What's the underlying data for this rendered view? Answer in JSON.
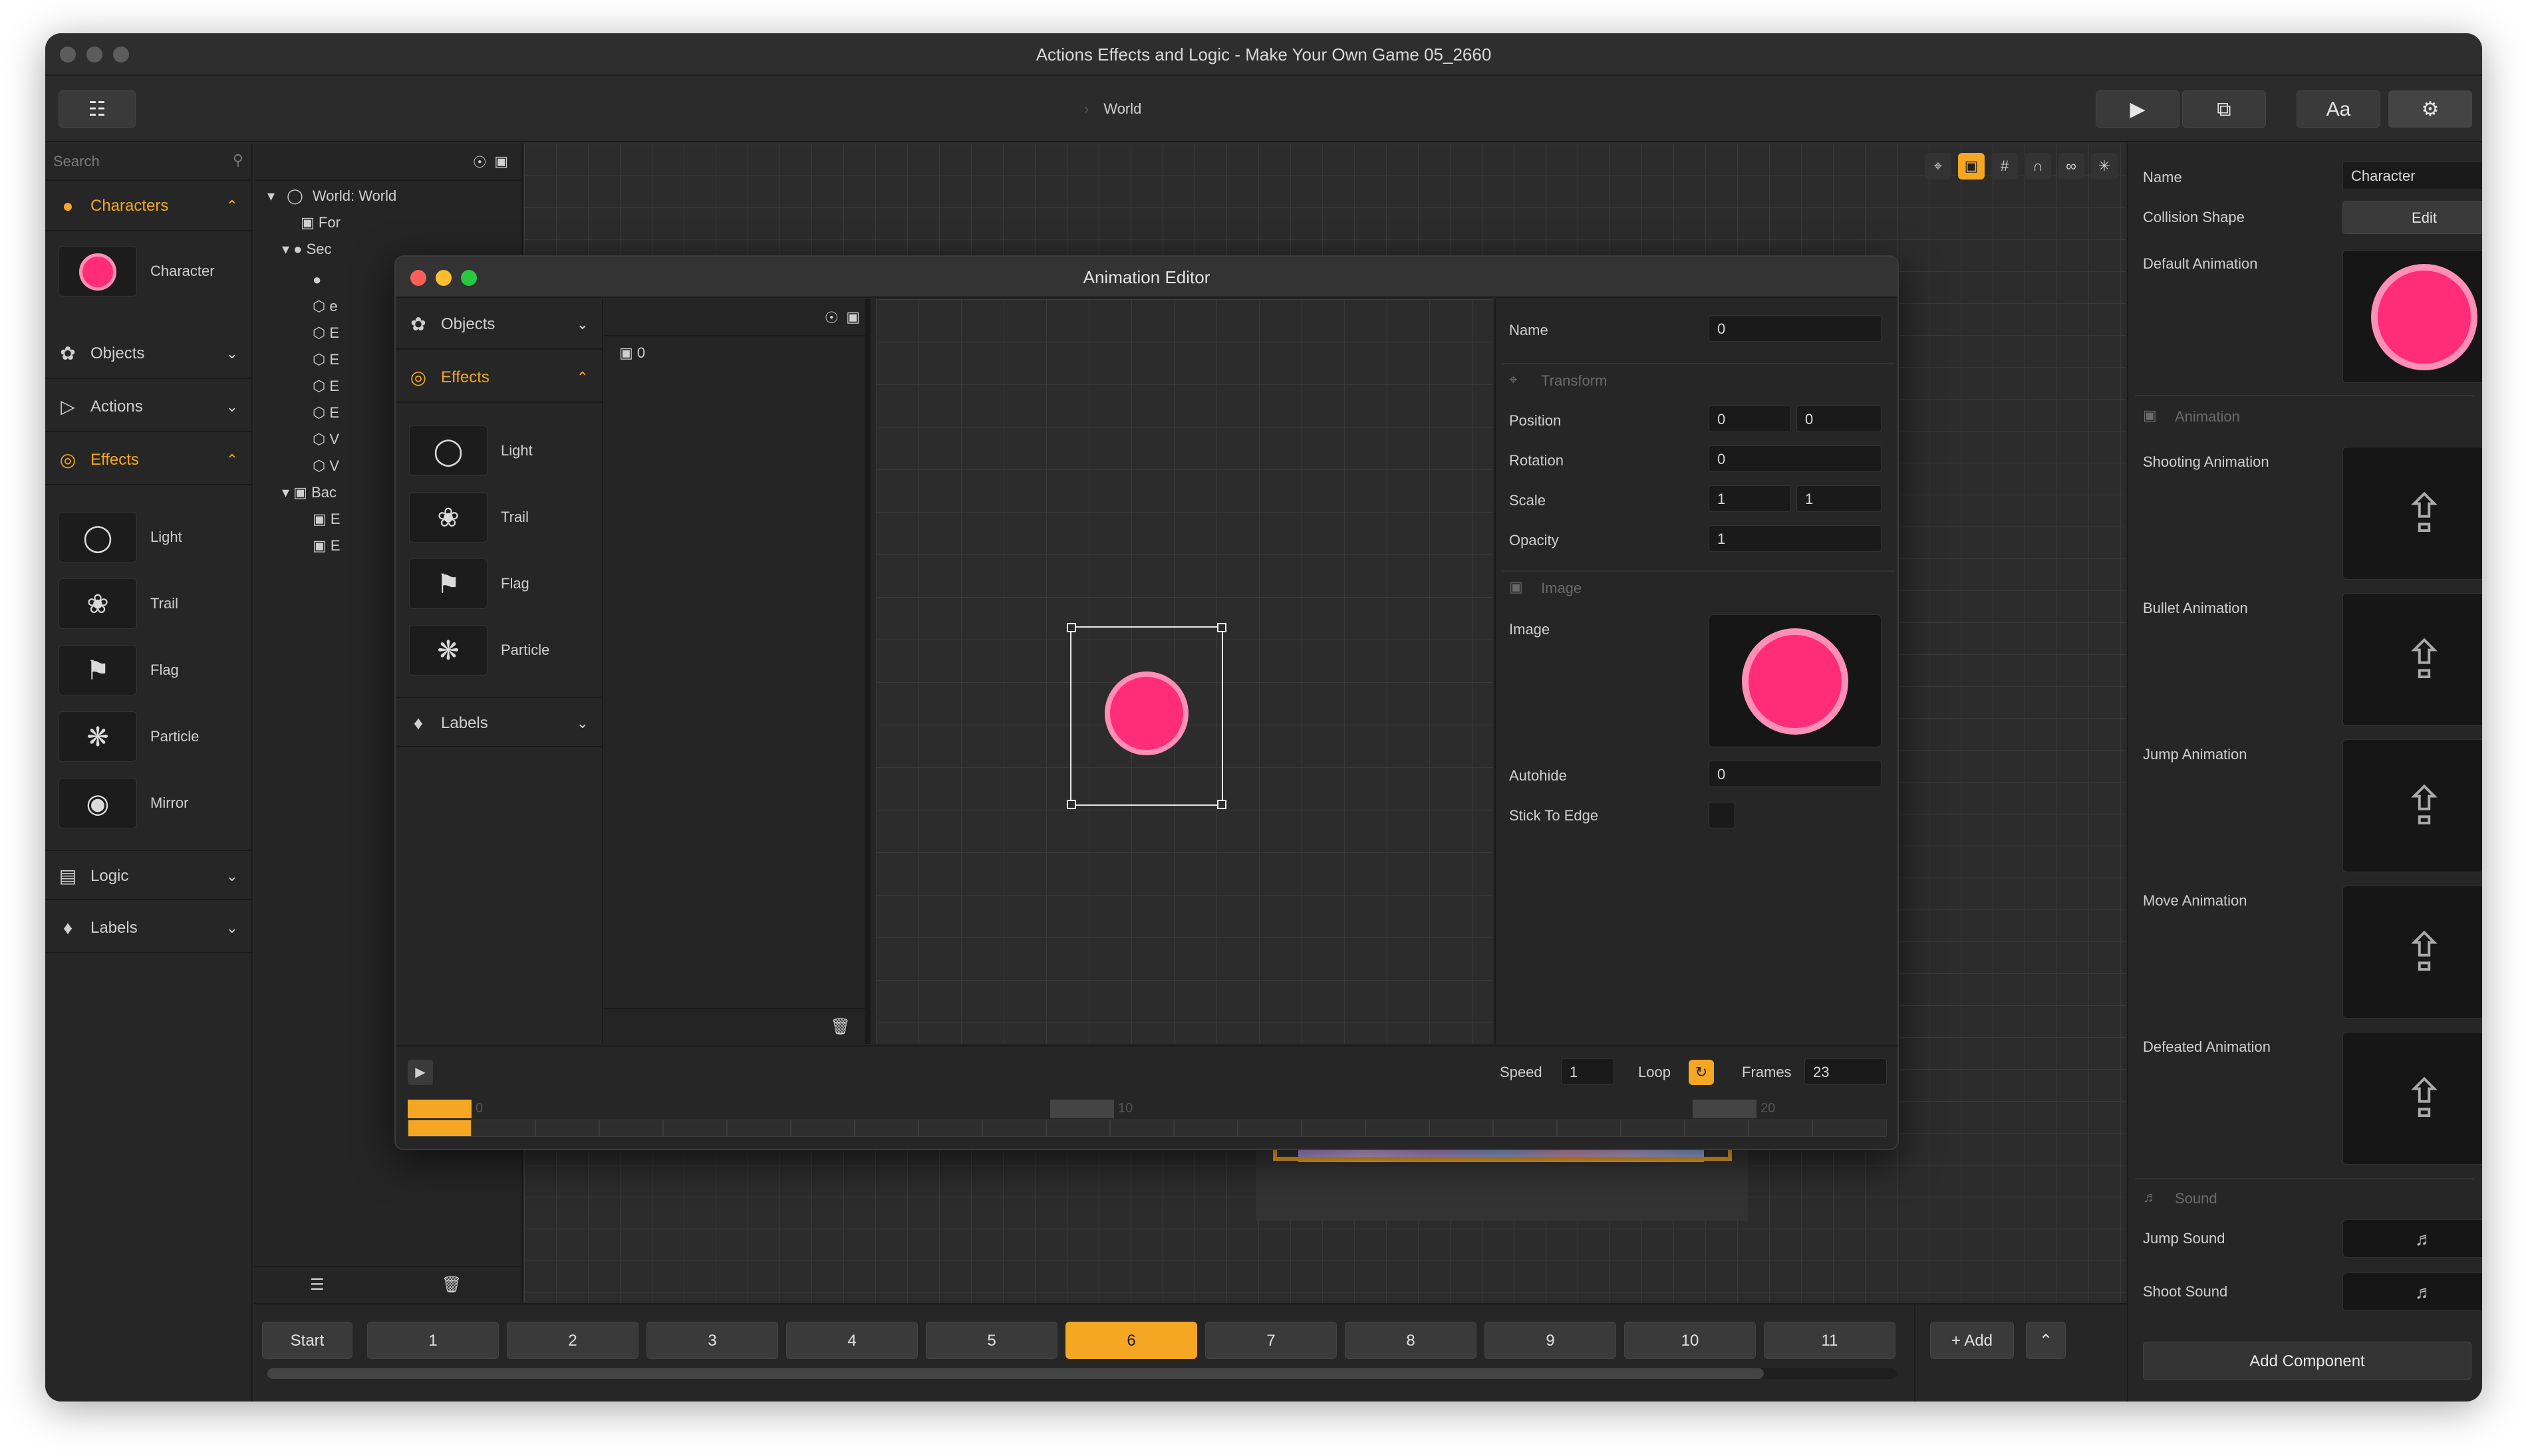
{
  "window": {
    "title": "Actions Effects and Logic - Make Your Own Game 05_2660"
  },
  "toolbar": {
    "breadcrumb": "World",
    "play_icon": "play-icon",
    "share_icon": "share-icon",
    "font_label": "Aa",
    "settings_icon": "gear-icon"
  },
  "sidebar": {
    "search_placeholder": "Search",
    "characters": {
      "label": "Characters",
      "items": [
        {
          "label": "Character"
        }
      ]
    },
    "objects": {
      "label": "Objects"
    },
    "actions": {
      "label": "Actions"
    },
    "effects": {
      "label": "Effects",
      "items": [
        {
          "label": "Light"
        },
        {
          "label": "Trail"
        },
        {
          "label": "Flag"
        },
        {
          "label": "Particle"
        },
        {
          "label": "Mirror"
        }
      ]
    },
    "logic": {
      "label": "Logic"
    },
    "labels": {
      "label": "Labels"
    }
  },
  "tree": {
    "root": "World: World",
    "rows": [
      "For",
      "Sec",
      "",
      "e",
      "E",
      "E",
      "E",
      "E",
      "V",
      "V",
      "Bac",
      "E",
      "E"
    ]
  },
  "animation_editor": {
    "title": "Animation Editor",
    "left": {
      "objects": "Objects",
      "effects": "Effects",
      "items": [
        {
          "label": "Light"
        },
        {
          "label": "Trail"
        },
        {
          "label": "Flag"
        },
        {
          "label": "Particle"
        }
      ],
      "labels": "Labels"
    },
    "layers": {
      "first": "0"
    },
    "props": {
      "name_label": "Name",
      "name_value": "0",
      "transform_section": "Transform",
      "position_label": "Position",
      "position_x": "0",
      "position_y": "0",
      "rotation_label": "Rotation",
      "rotation_value": "0",
      "scale_label": "Scale",
      "scale_x": "1",
      "scale_y": "1",
      "opacity_label": "Opacity",
      "opacity_value": "1",
      "image_section": "Image",
      "image_label": "Image",
      "autohide_label": "Autohide",
      "autohide_value": "0",
      "stick_label": "Stick To Edge"
    },
    "timeline": {
      "speed_label": "Speed",
      "speed_value": "1",
      "loop_label": "Loop",
      "frames_label": "Frames",
      "frames_value": "23",
      "markers": [
        "0",
        "10",
        "20"
      ]
    }
  },
  "inspector": {
    "name_label": "Name",
    "name_value": "Character",
    "collision_label": "Collision Shape",
    "collision_button": "Edit",
    "default_anim_label": "Default Animation",
    "animation_section": "Animation",
    "anims": [
      "Shooting Animation",
      "Bullet Animation",
      "Jump Animation",
      "Move Animation",
      "Defeated Animation"
    ],
    "sound_section": "Sound",
    "jump_sound": "Jump Sound",
    "shoot_sound": "Shoot Sound",
    "add_component": "Add Component"
  },
  "frames": {
    "start": "Start",
    "items": [
      "1",
      "2",
      "3",
      "4",
      "5",
      "6",
      "7",
      "8",
      "9",
      "10",
      "11"
    ],
    "selected": "6",
    "add": "Add"
  },
  "colors": {
    "accent": "#f5a623",
    "character": "#ff2d78"
  }
}
